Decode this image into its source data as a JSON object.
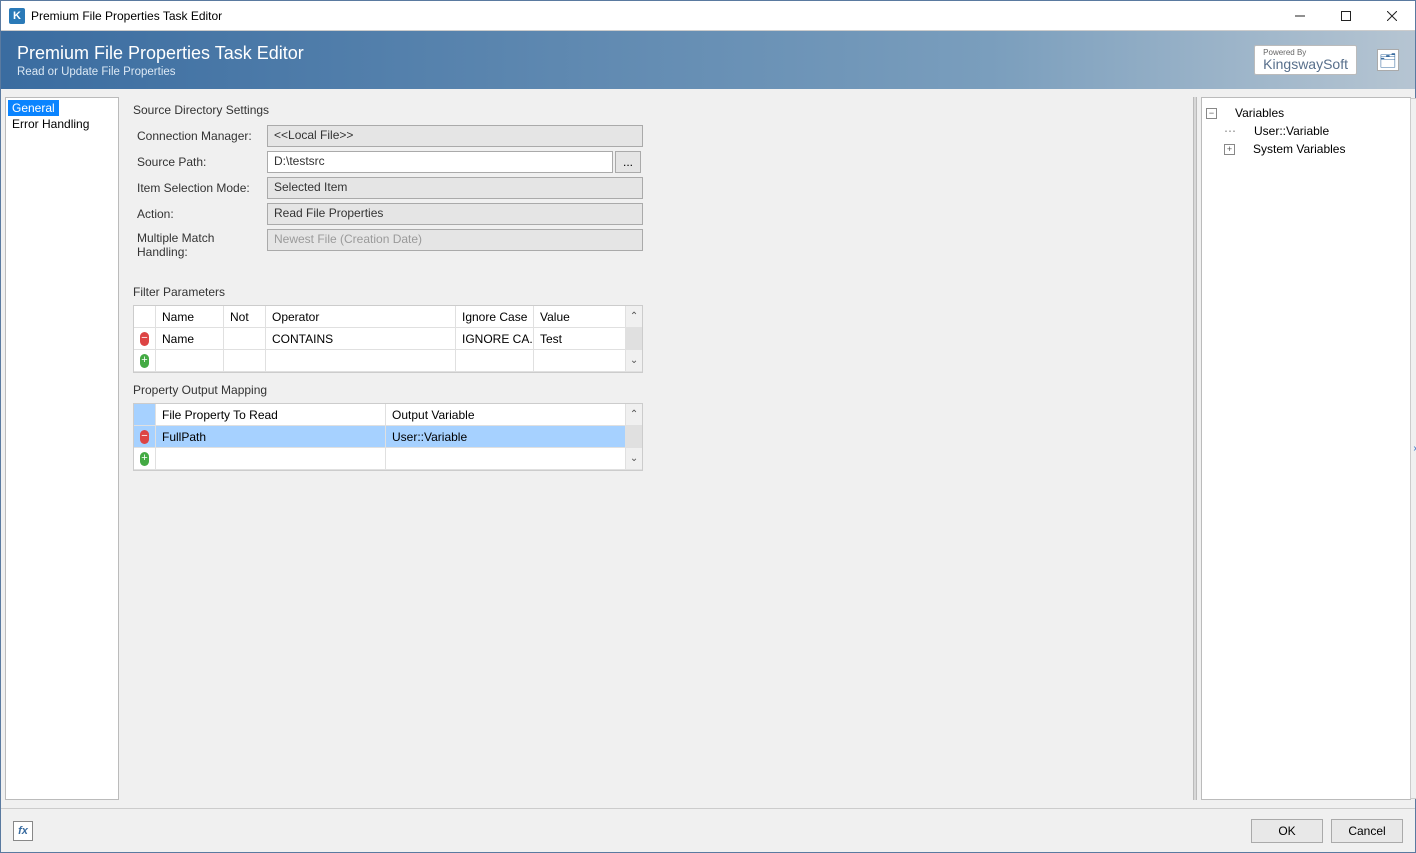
{
  "window": {
    "title": "Premium File Properties Task Editor"
  },
  "banner": {
    "heading": "Premium File Properties Task Editor",
    "sub": "Read or Update File Properties",
    "vendor_small": "Powered By",
    "vendor": "KingswaySoft"
  },
  "nav": {
    "items": [
      {
        "label": "General",
        "selected": true
      },
      {
        "label": "Error Handling",
        "selected": false
      }
    ]
  },
  "source_settings": {
    "title": "Source Directory Settings",
    "labels": {
      "connection": "Connection Manager:",
      "path": "Source Path:",
      "mode": "Item Selection Mode:",
      "action": "Action:",
      "match": "Multiple Match Handling:"
    },
    "values": {
      "connection": "<<Local File>>",
      "path": "D:\\testsrc",
      "mode": "Selected Item",
      "action": "Read File Properties",
      "match": "Newest File (Creation Date)"
    },
    "browse": "..."
  },
  "filter": {
    "title": "Filter Parameters",
    "headers": {
      "name": "Name",
      "not": "Not",
      "operator": "Operator",
      "ignore": "Ignore Case",
      "value": "Value"
    },
    "rows": [
      {
        "name": "Name",
        "not": "",
        "operator": "CONTAINS",
        "ignore": "IGNORE CA...",
        "value": "Test"
      }
    ]
  },
  "mapping": {
    "title": "Property Output Mapping",
    "headers": {
      "prop": "File Property To Read",
      "ovar": "Output Variable"
    },
    "rows": [
      {
        "prop": "FullPath",
        "ovar": "User::Variable",
        "selected": true
      }
    ]
  },
  "variables": {
    "root": "Variables",
    "user_var": "User::Variable",
    "system": "System Variables"
  },
  "footer": {
    "ok": "OK",
    "cancel": "Cancel"
  }
}
